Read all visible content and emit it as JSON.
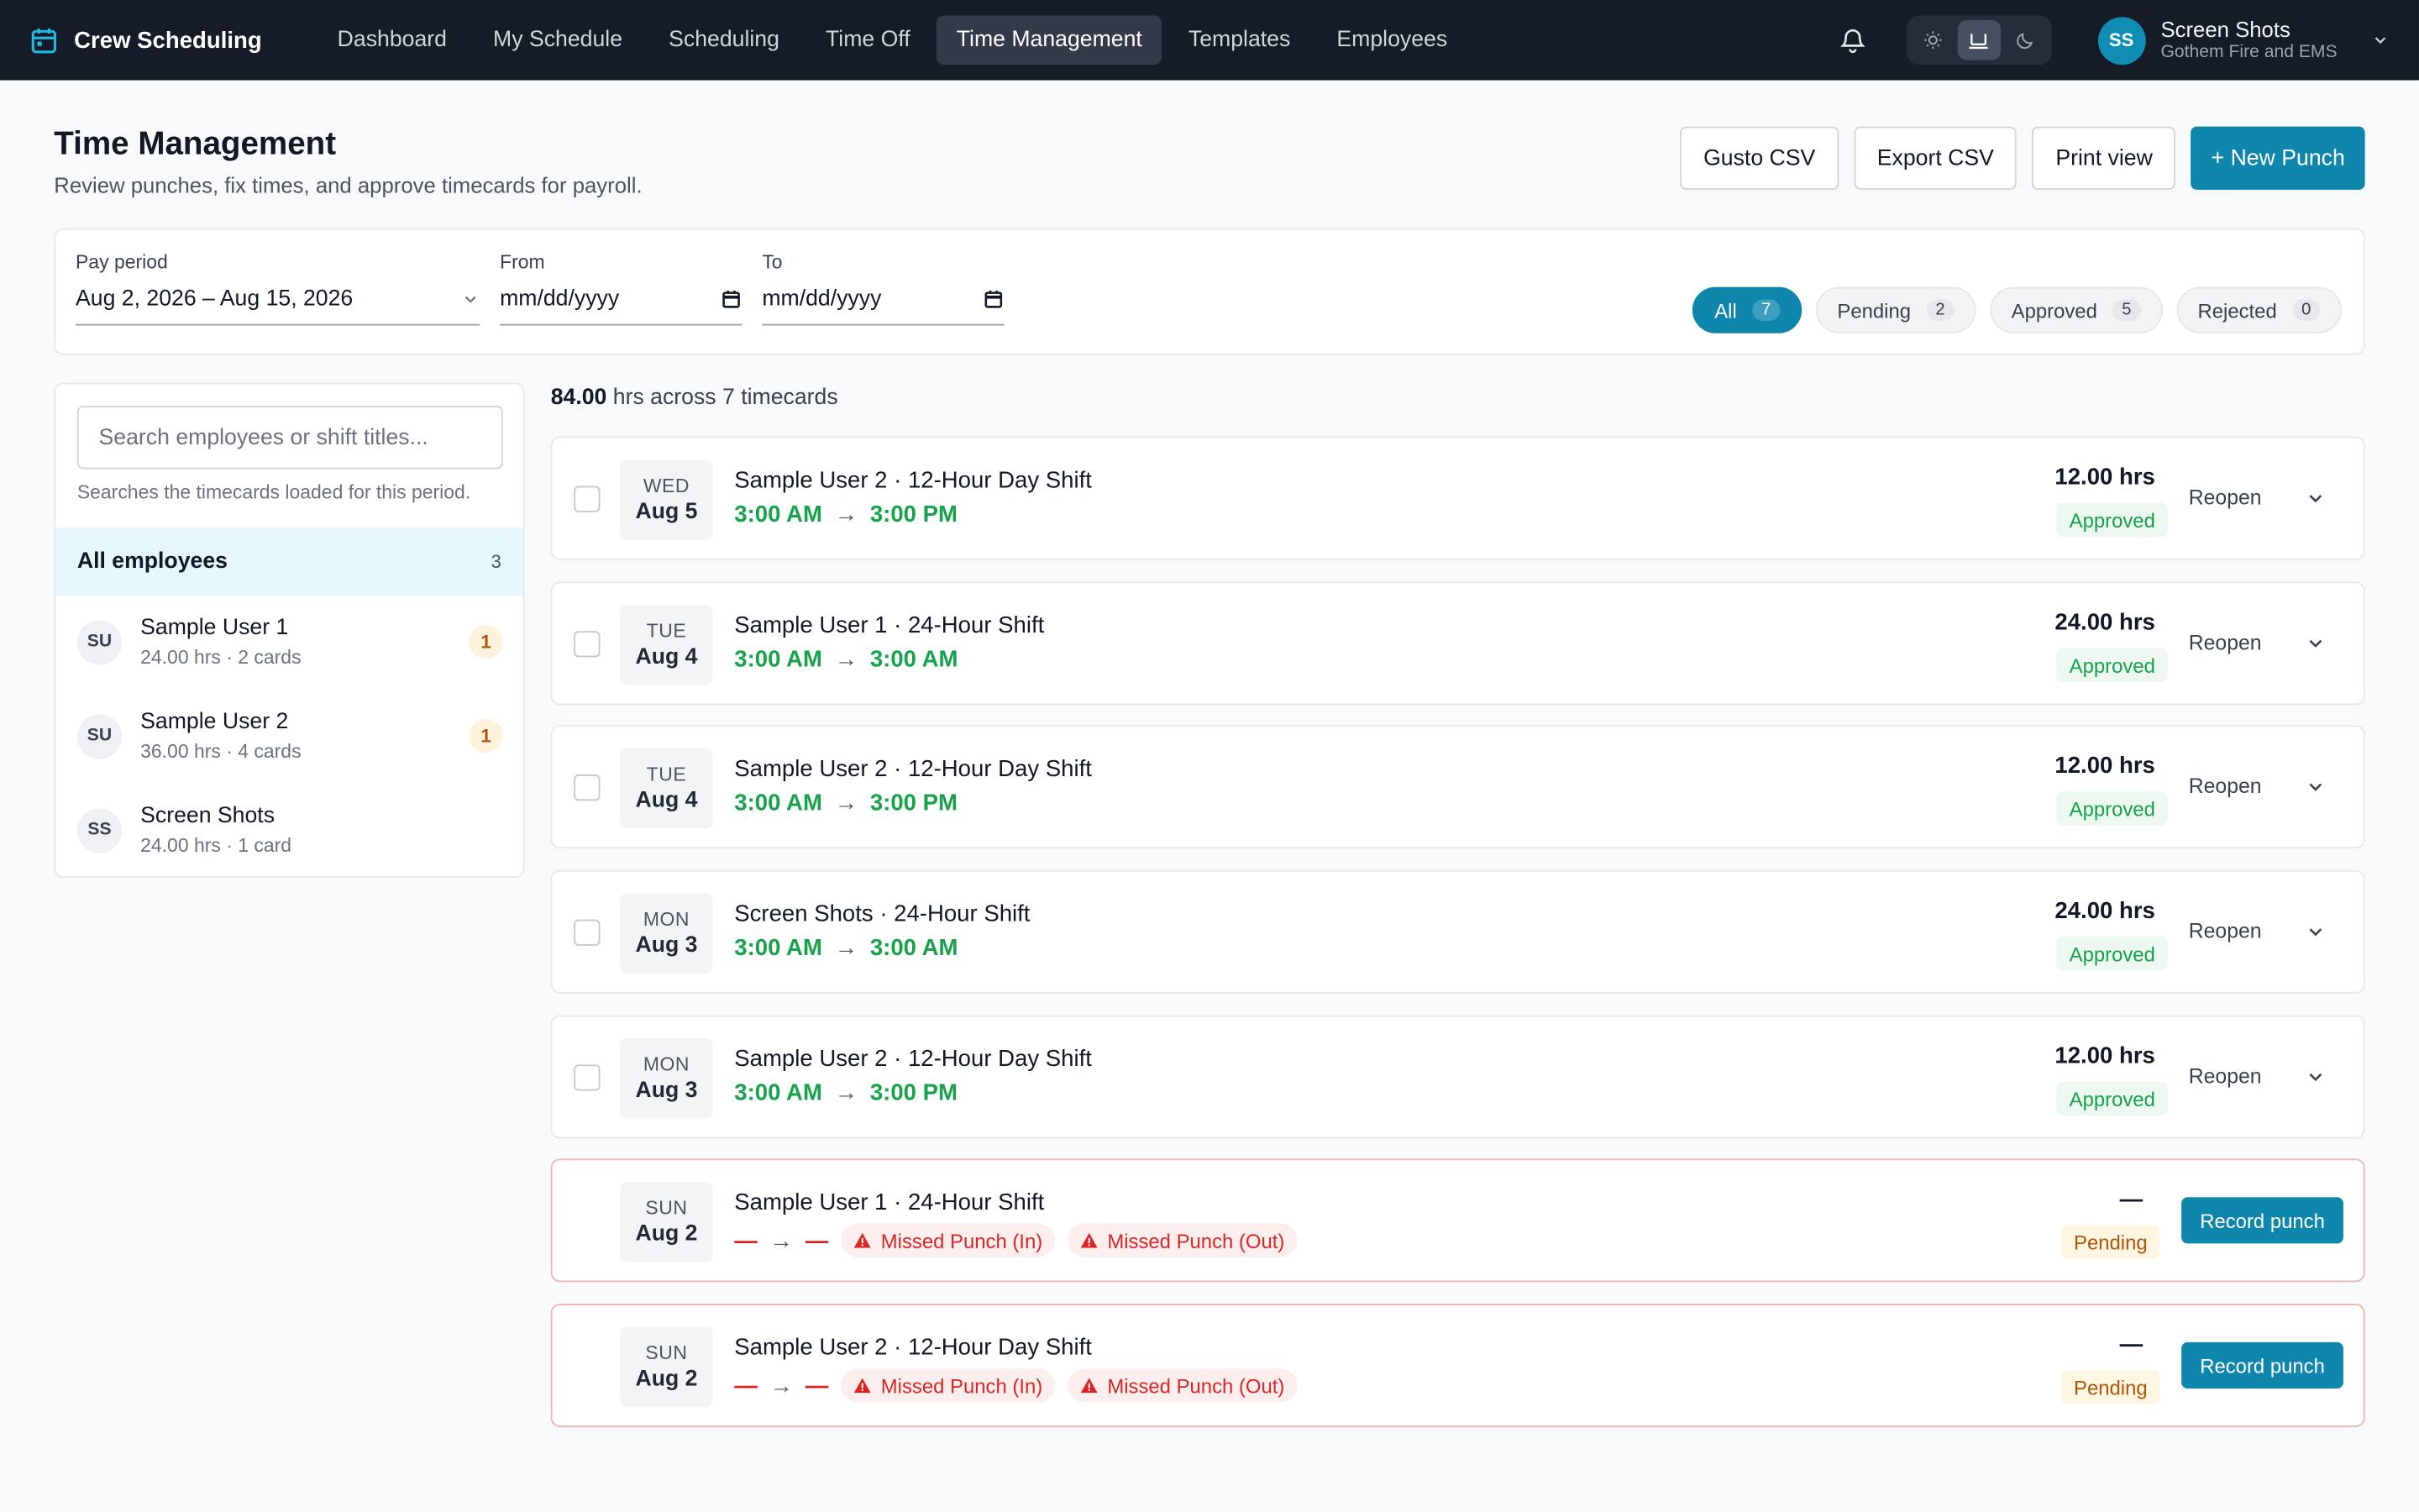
{
  "app": {
    "name": "Crew Scheduling"
  },
  "nav": {
    "links": [
      {
        "label": "Dashboard"
      },
      {
        "label": "My Schedule"
      },
      {
        "label": "Scheduling"
      },
      {
        "label": "Time Off"
      },
      {
        "label": "Time Management"
      },
      {
        "label": "Templates"
      },
      {
        "label": "Employees"
      }
    ],
    "active": "Time Management"
  },
  "user": {
    "initials": "SS",
    "name": "Screen Shots",
    "org": "Gothem Fire and EMS"
  },
  "header": {
    "title": "Time Management",
    "subtitle": "Review punches, fix times, and approve timecards for payroll.",
    "actions": {
      "gusto": "Gusto CSV",
      "export": "Export CSV",
      "print": "Print view",
      "new_punch": "+ New Punch"
    }
  },
  "filters": {
    "pay_period": {
      "label": "Pay period",
      "value": "Aug 2, 2026 – Aug 15, 2026"
    },
    "from": {
      "label": "From",
      "value": "mm/dd/yyyy"
    },
    "to": {
      "label": "To",
      "value": "mm/dd/yyyy"
    },
    "status_pills": [
      {
        "label": "All",
        "count": "7",
        "active": true
      },
      {
        "label": "Pending",
        "count": "2"
      },
      {
        "label": "Approved",
        "count": "5"
      },
      {
        "label": "Rejected",
        "count": "0"
      }
    ]
  },
  "sidebar": {
    "search_placeholder": "Search employees or shift titles...",
    "search_hint": "Searches the timecards loaded for this period.",
    "all": {
      "label": "All employees",
      "count": "3"
    },
    "employees": [
      {
        "initials": "SU",
        "name": "Sample User 1",
        "meta": "24.00 hrs · 2 cards",
        "badge": "1"
      },
      {
        "initials": "SU",
        "name": "Sample User 2",
        "meta": "36.00 hrs · 4 cards",
        "badge": "1"
      },
      {
        "initials": "SS",
        "name": "Screen Shots",
        "meta": "24.00 hrs · 1 card",
        "badge": ""
      }
    ]
  },
  "summary": {
    "hours": "84.00",
    "rest": "hrs across 7 timecards"
  },
  "timecards": [
    {
      "dow": "WED",
      "date": "Aug 5",
      "title": "Sample User 2 · 12-Hour Day Shift",
      "start": "3:00 AM",
      "end": "3:00 PM",
      "hours": "12.00 hrs",
      "status": "Approved",
      "action": "Reopen"
    },
    {
      "dow": "TUE",
      "date": "Aug 4",
      "title": "Sample User 1 · 24-Hour Shift",
      "start": "3:00 AM",
      "end": "3:00 AM",
      "hours": "24.00 hrs",
      "status": "Approved",
      "action": "Reopen"
    },
    {
      "dow": "TUE",
      "date": "Aug 4",
      "title": "Sample User 2 · 12-Hour Day Shift",
      "start": "3:00 AM",
      "end": "3:00 PM",
      "hours": "12.00 hrs",
      "status": "Approved",
      "action": "Reopen"
    },
    {
      "dow": "MON",
      "date": "Aug 3",
      "title": "Screen Shots · 24-Hour Shift",
      "start": "3:00 AM",
      "end": "3:00 AM",
      "hours": "24.00 hrs",
      "status": "Approved",
      "action": "Reopen"
    },
    {
      "dow": "MON",
      "date": "Aug 3",
      "title": "Sample User 2 · 12-Hour Day Shift",
      "start": "3:00 AM",
      "end": "3:00 PM",
      "hours": "12.00 hrs",
      "status": "Approved",
      "action": "Reopen"
    },
    {
      "dow": "SUN",
      "date": "Aug 2",
      "title": "Sample User 1 · 24-Hour Shift",
      "start": "—",
      "end": "—",
      "missed_in": "Missed Punch (In)",
      "missed_out": "Missed Punch (Out)",
      "hours": "—",
      "status": "Pending",
      "action": "Record punch"
    },
    {
      "dow": "SUN",
      "date": "Aug 2",
      "title": "Sample User 2 · 12-Hour Day Shift",
      "start": "—",
      "end": "—",
      "missed_in": "Missed Punch (In)",
      "missed_out": "Missed Punch (Out)",
      "hours": "—",
      "status": "Pending",
      "action": "Record punch"
    }
  ],
  "colors": {
    "accent": "#0f87ad",
    "nav_bg": "#151b27",
    "approved": "#16a34a",
    "missed": "#dc2626",
    "pending": "#b45309"
  }
}
